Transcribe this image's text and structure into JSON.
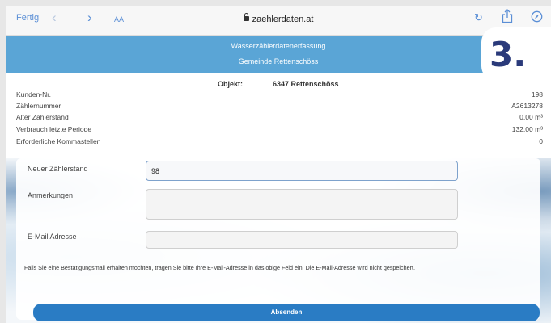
{
  "browser": {
    "done_label": "Fertig",
    "back_icon": "‹",
    "forward_icon": "›",
    "text_size_label": "AA",
    "url": "zaehlerdaten.at",
    "reload_icon": "↻"
  },
  "header": {
    "title": "Wasserzählerdatenerfassung",
    "subtitle": "Gemeinde Rettenschöss"
  },
  "step_badge": "3.",
  "object": {
    "label": "Objekt:",
    "value": "6347 Rettenschöss"
  },
  "info_rows": [
    {
      "key": "Kunden-Nr.",
      "value": "198"
    },
    {
      "key": "Zählernummer",
      "value": "A2613278"
    },
    {
      "key": "Alter Zählerstand",
      "value": "0,00 m³"
    },
    {
      "key": "Verbrauch letzte Periode",
      "value": "132,00 m³"
    },
    {
      "key": "Erforderliche Kommastellen",
      "value": "0"
    }
  ],
  "form": {
    "new_reading_label": "Neuer Zählerstand",
    "new_reading_value": "98",
    "remarks_label": "Anmerkungen",
    "remarks_value": "",
    "email_label": "E-Mail Adresse",
    "email_value": "",
    "hint": "Falls Sie eine Bestätigungsmail erhalten möchten, tragen Sie bitte Ihre E-Mail-Adresse in das obige Feld ein. Die E-Mail-Adresse wird nicht gespeichert.",
    "submit_label": "Absenden"
  }
}
